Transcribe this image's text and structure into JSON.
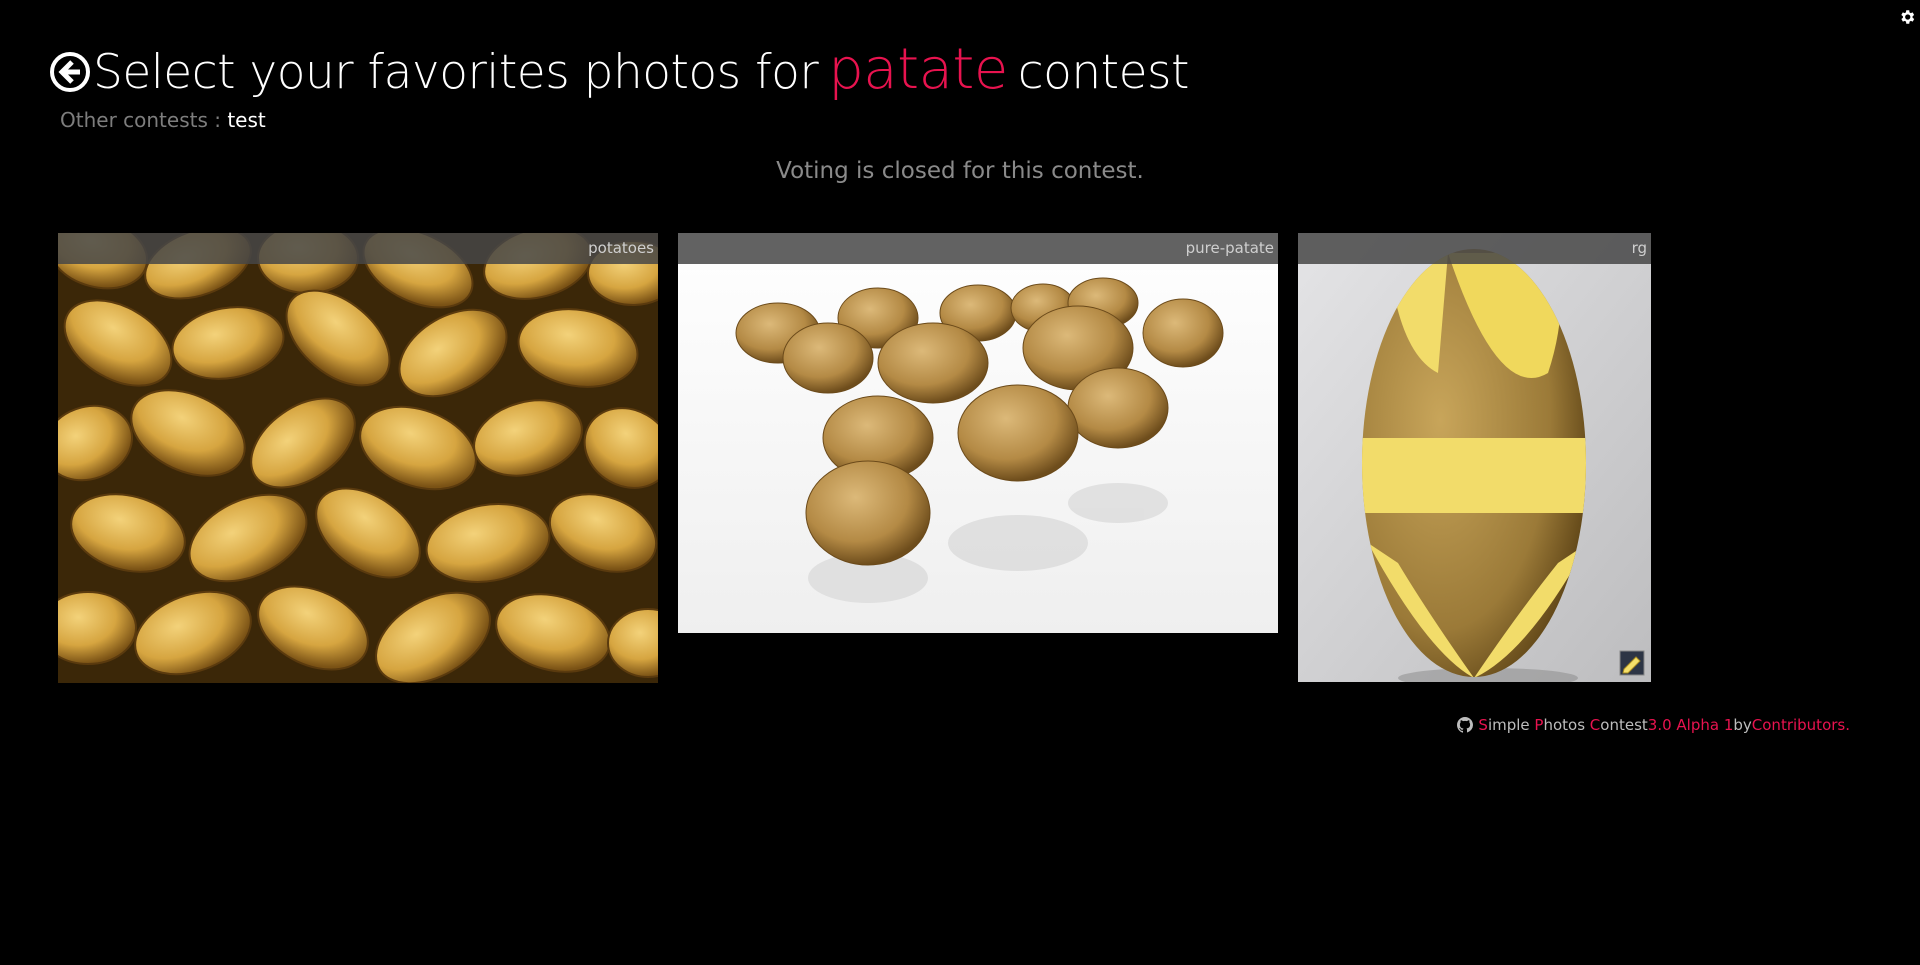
{
  "header": {
    "title_prefix": "Select your favorites photos for",
    "contest_name": "patate",
    "title_suffix": "contest",
    "back_icon": "circle-arrow-left-icon",
    "settings_icon": "gear-icon"
  },
  "other_contests": {
    "label": "Other contests :",
    "items": [
      "test"
    ]
  },
  "status": {
    "message": "Voting is closed for this contest."
  },
  "photos": [
    {
      "caption": "potatoes"
    },
    {
      "caption": "pure-patate"
    },
    {
      "caption": "rg"
    }
  ],
  "footer": {
    "github_icon": "github-icon",
    "s": "S",
    "imple": "imple ",
    "p": "P",
    "hotos": "hotos ",
    "c": "C",
    "ontest": "ontest ",
    "version": "3.0 Alpha 1",
    "by": " by ",
    "contributors": "Contributors."
  },
  "colors": {
    "accent": "#e8134f",
    "background": "#000000"
  }
}
